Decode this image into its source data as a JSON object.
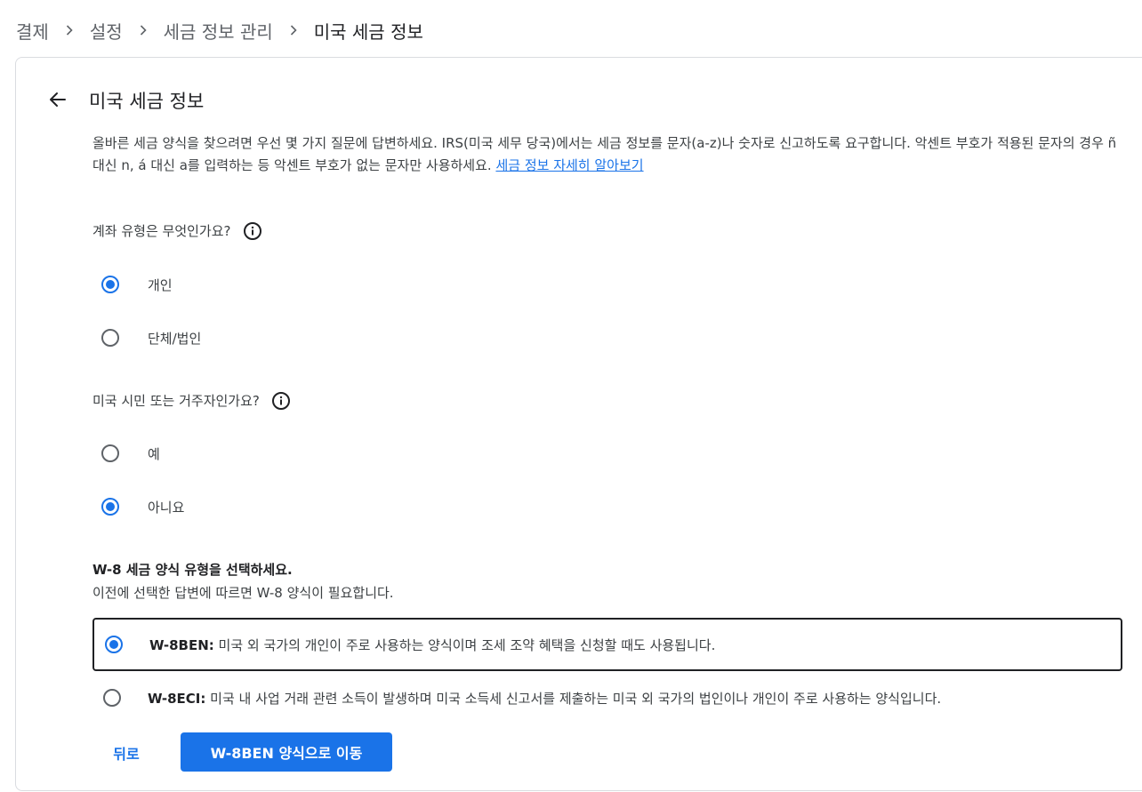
{
  "breadcrumb": {
    "items": [
      "결제",
      "설정",
      "세금 정보 관리",
      "미국 세금 정보"
    ]
  },
  "card": {
    "title": "미국 세금 정보",
    "intro_text": "올바른 세금 양식을 찾으려면 우선 몇 가지 질문에 답변하세요. IRS(미국 세무 당국)에서는 세금 정보를 문자(a-z)나 숫자로 신고하도록 요구합니다. 악센트 부호가 적용된 문자의 경우 ñ 대신 n, á 대신 a를 입력하는 등 악센트 부호가 없는 문자만 사용하세요. ",
    "intro_link": "세금 정보 자세히 알아보기"
  },
  "q1": {
    "label": "계좌 유형은 무엇인가요?",
    "options": [
      {
        "label": "개인",
        "checked": true
      },
      {
        "label": "단체/법인",
        "checked": false
      }
    ]
  },
  "q2": {
    "label": "미국 시민 또는 거주자인가요?",
    "options": [
      {
        "label": "예",
        "checked": false
      },
      {
        "label": "아니요",
        "checked": true
      }
    ]
  },
  "w8": {
    "title": "W-8 세금 양식 유형을 선택하세요.",
    "subtitle": "이전에 선택한 답변에 따르면 W-8 양식이 필요합니다.",
    "options": [
      {
        "name": "W-8BEN:",
        "desc": " 미국 외 국가의 개인이 주로 사용하는 양식이며 조세 조약 혜택을 신청할 때도 사용됩니다.",
        "checked": true
      },
      {
        "name": "W-8ECI:",
        "desc": " 미국 내 사업 거래 관련 소득이 발생하며 미국 소득세 신고서를 제출하는 미국 외 국가의 법인이나 개인이 주로 사용하는 양식입니다.",
        "checked": false
      }
    ]
  },
  "buttons": {
    "back_label": "뒤로",
    "primary_label": "W-8BEN 양식으로 이동"
  },
  "colors": {
    "accent": "#1a73e8",
    "text": "#202124",
    "secondary_text": "#5f6368",
    "border": "#dadce0"
  },
  "icons": {
    "back": "arrow-back-icon",
    "info": "info-icon",
    "breadcrumb_separator": "chevron-right-icon"
  }
}
